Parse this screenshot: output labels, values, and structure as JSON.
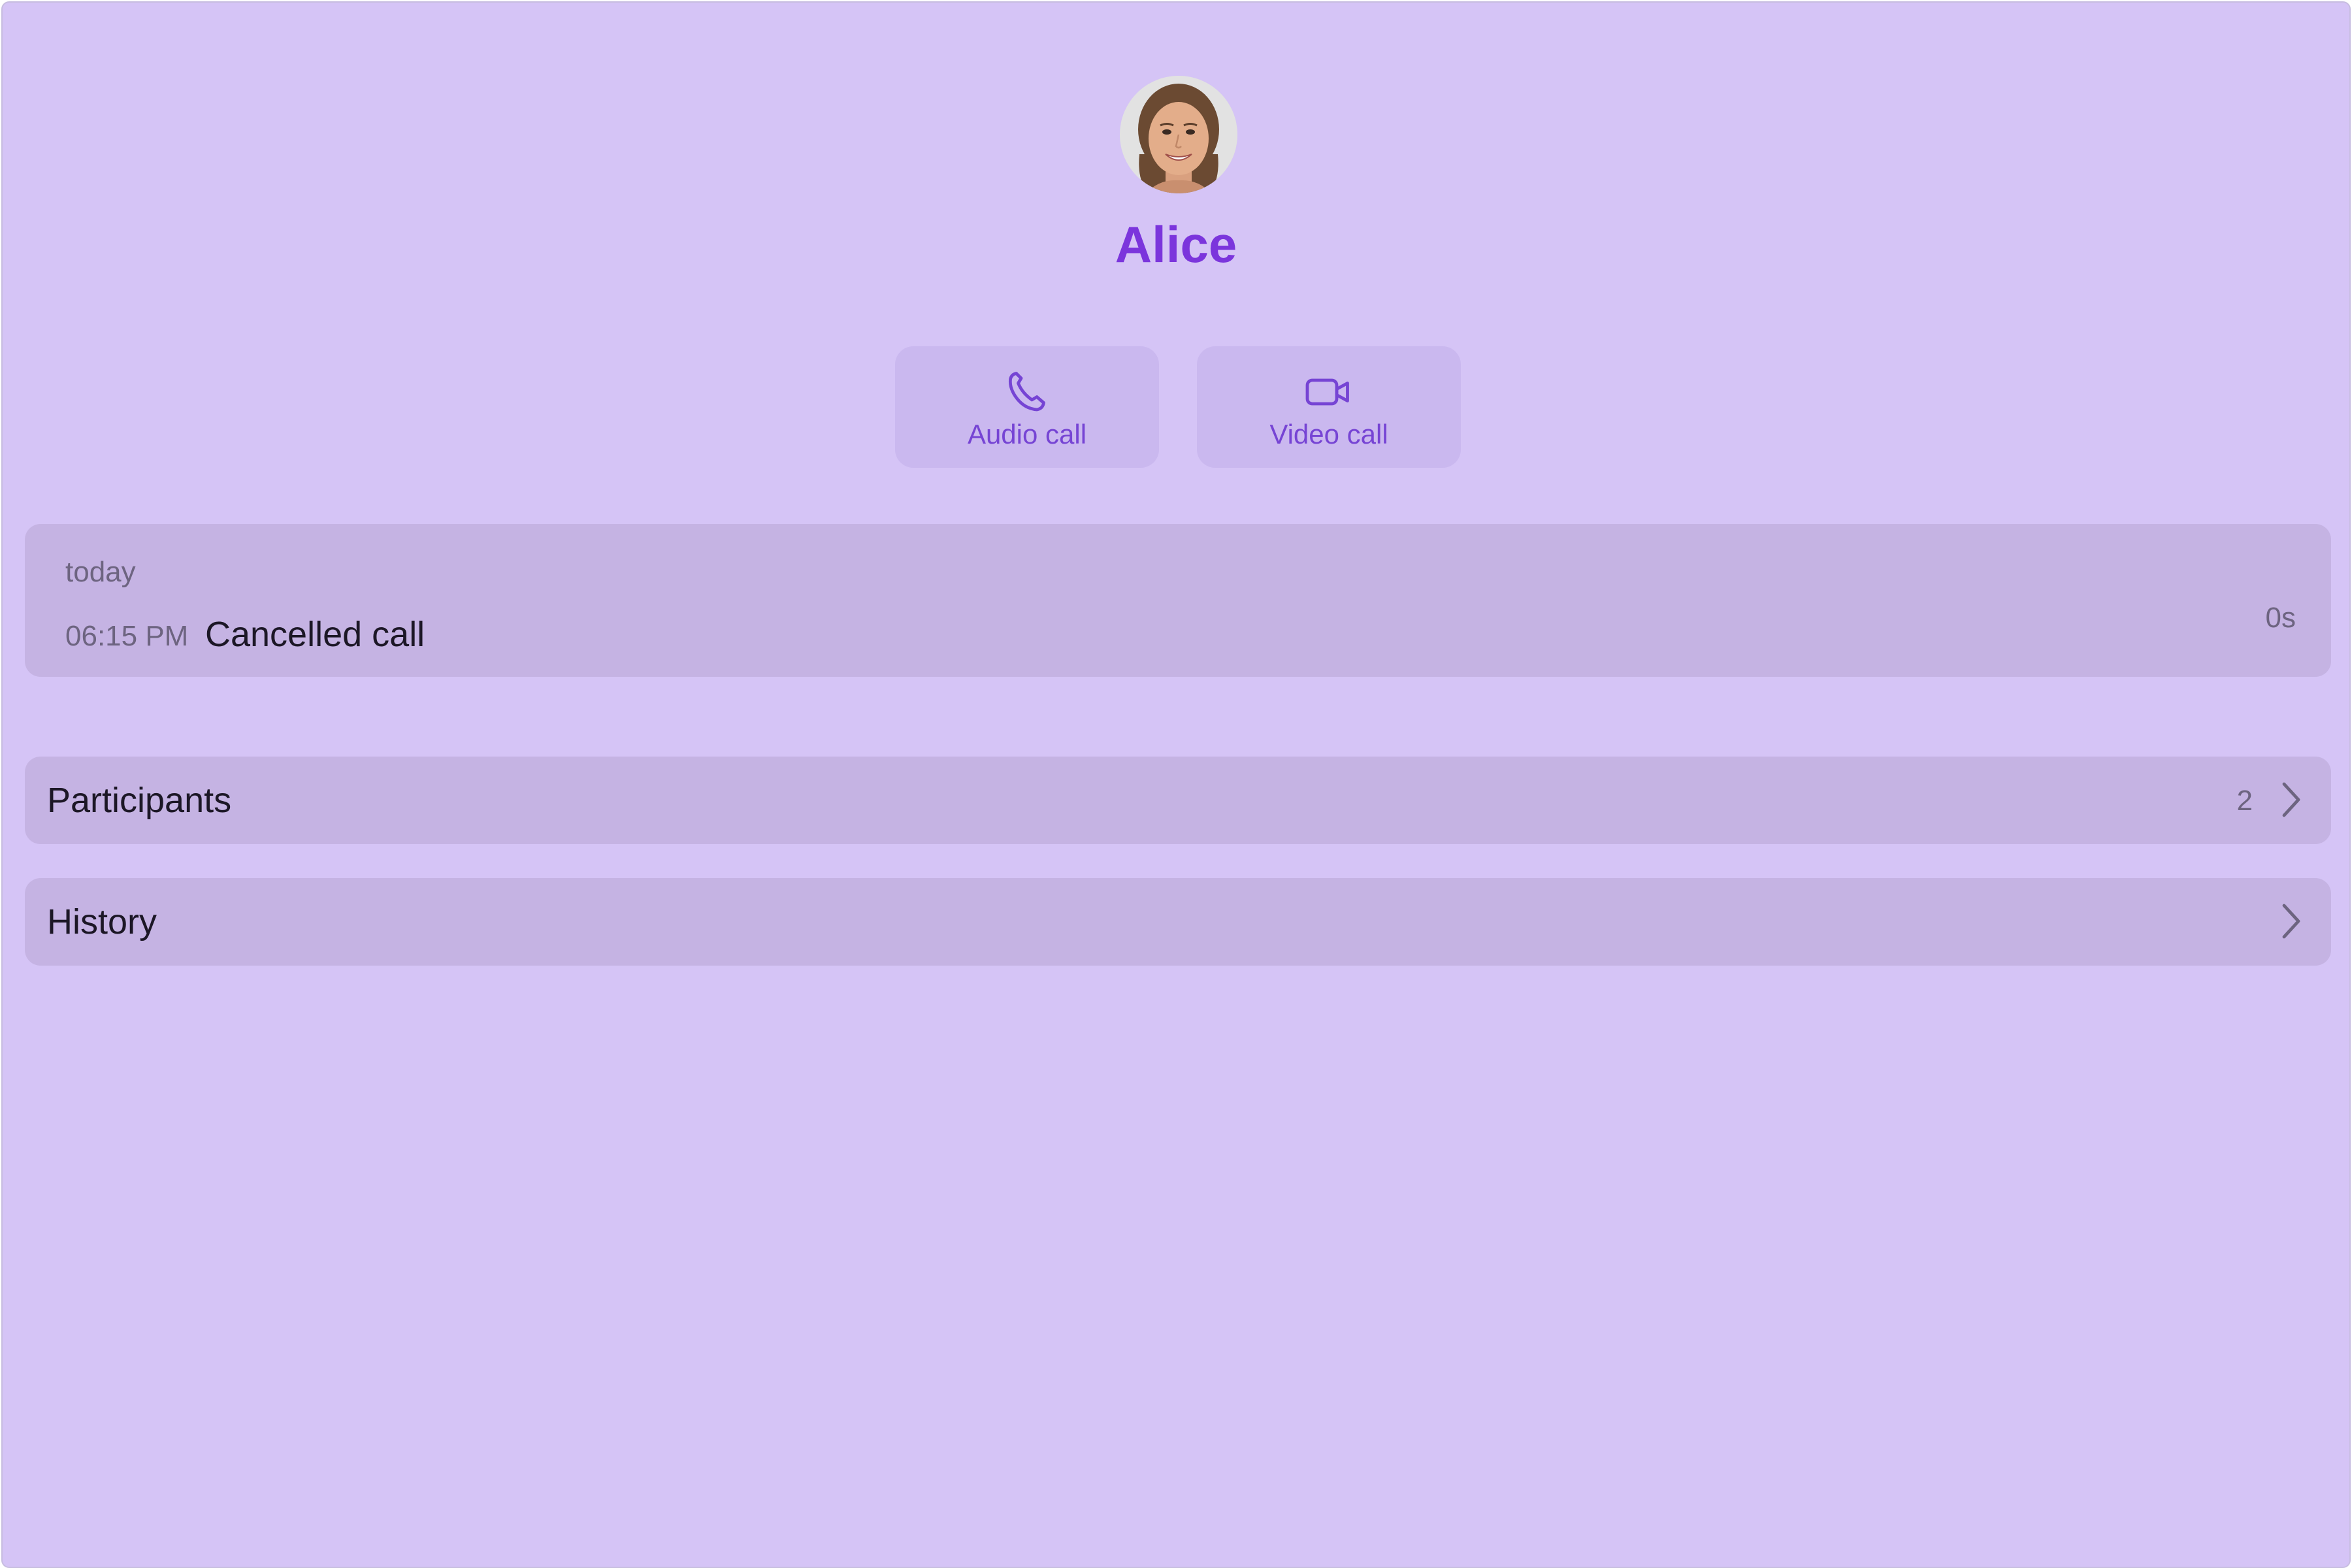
{
  "contact": {
    "name": "Alice",
    "avatar_icon": "avatar-photo"
  },
  "actions": {
    "audio": {
      "label": "Audio call",
      "icon": "phone-icon"
    },
    "video": {
      "label": "Video call",
      "icon": "video-camera-icon"
    }
  },
  "recent_call": {
    "day": "today",
    "time": "06:15 PM",
    "status": "Cancelled call",
    "duration": "0s"
  },
  "sections": {
    "participants": {
      "label": "Participants",
      "count": "2",
      "icon": "chevron-right-icon"
    },
    "history": {
      "label": "History",
      "icon": "chevron-right-icon"
    }
  },
  "colors": {
    "background": "#d5c4f6",
    "card": "#c5b3e3",
    "button": "#cab8ef",
    "accent": "#7b35dc",
    "button_text": "#7644d4",
    "primary_text": "#1c1726",
    "secondary_text": "#6d6480"
  }
}
